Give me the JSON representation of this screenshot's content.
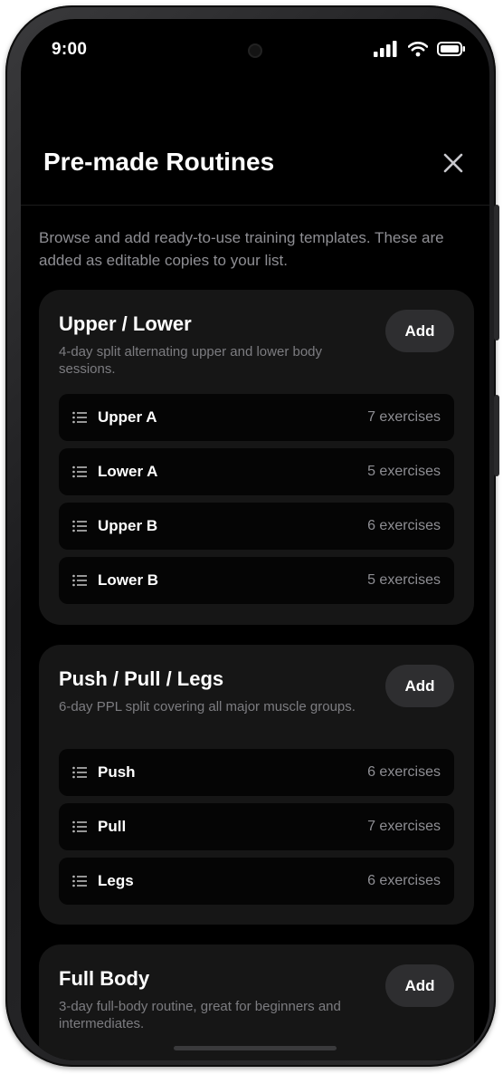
{
  "status_bar": {
    "time": "9:00"
  },
  "header": {
    "title": "Pre-made Routines"
  },
  "intro": "Browse and add ready-to-use training templates. These are added as editable copies to your list.",
  "add_label": "Add",
  "routines": [
    {
      "title": "Upper / Lower",
      "description": "4-day split alternating upper and lower body sessions.",
      "days": [
        {
          "name": "Upper A",
          "count": "7 exercises"
        },
        {
          "name": "Lower A",
          "count": "5 exercises"
        },
        {
          "name": "Upper B",
          "count": "6 exercises"
        },
        {
          "name": "Lower B",
          "count": "5 exercises"
        }
      ]
    },
    {
      "title": "Push / Pull / Legs",
      "description": "6-day PPL split covering all major muscle groups.",
      "days": [
        {
          "name": "Push",
          "count": "6 exercises"
        },
        {
          "name": "Pull",
          "count": "7 exercises"
        },
        {
          "name": "Legs",
          "count": "6 exercises"
        }
      ]
    },
    {
      "title": "Full Body",
      "description": "3-day full-body routine, great for beginners and intermediates.",
      "days": []
    }
  ],
  "icons": {
    "signal": "cellular-signal-icon",
    "wifi": "wifi-icon",
    "battery": "battery-icon",
    "close": "close-icon",
    "list": "list-icon"
  }
}
